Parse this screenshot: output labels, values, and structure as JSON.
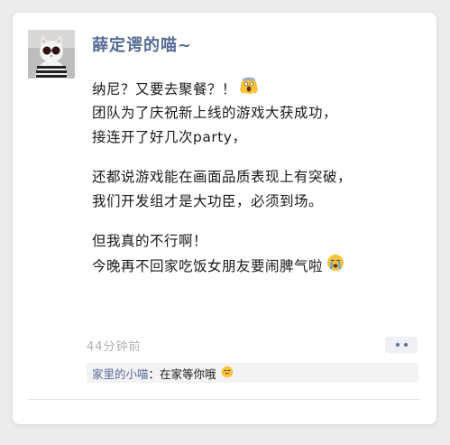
{
  "post": {
    "username": "薛定谔的喵~",
    "lines_para1": [
      "纳尼？又要去聚餐？！",
      "团队为了庆祝新上线的游戏大获成功，",
      "接连开了好几次party，"
    ],
    "lines_para2": [
      "还都说游戏能在画面品质表现上有突破，",
      "我们开发组才是大功臣，必须到场。"
    ],
    "lines_para3": [
      "但我真的不行啊！",
      "今晚再不回家吃饭女朋友要闹脾气啦"
    ],
    "timestamp": "44分钟前"
  },
  "comment": {
    "user": "家里的小喵",
    "separator": "：",
    "text": "在家等你哦"
  },
  "icons": {
    "line1_end": "screaming-face-emoji",
    "para3_end": "crying-face-emoji",
    "comment_end": "smirk-face-emoji",
    "more": "more-dots-icon"
  },
  "colors": {
    "name": "#576b95",
    "text": "#1a1a1a",
    "meta": "#b2b2b2",
    "emoji_yellow": "#f7c33b"
  }
}
